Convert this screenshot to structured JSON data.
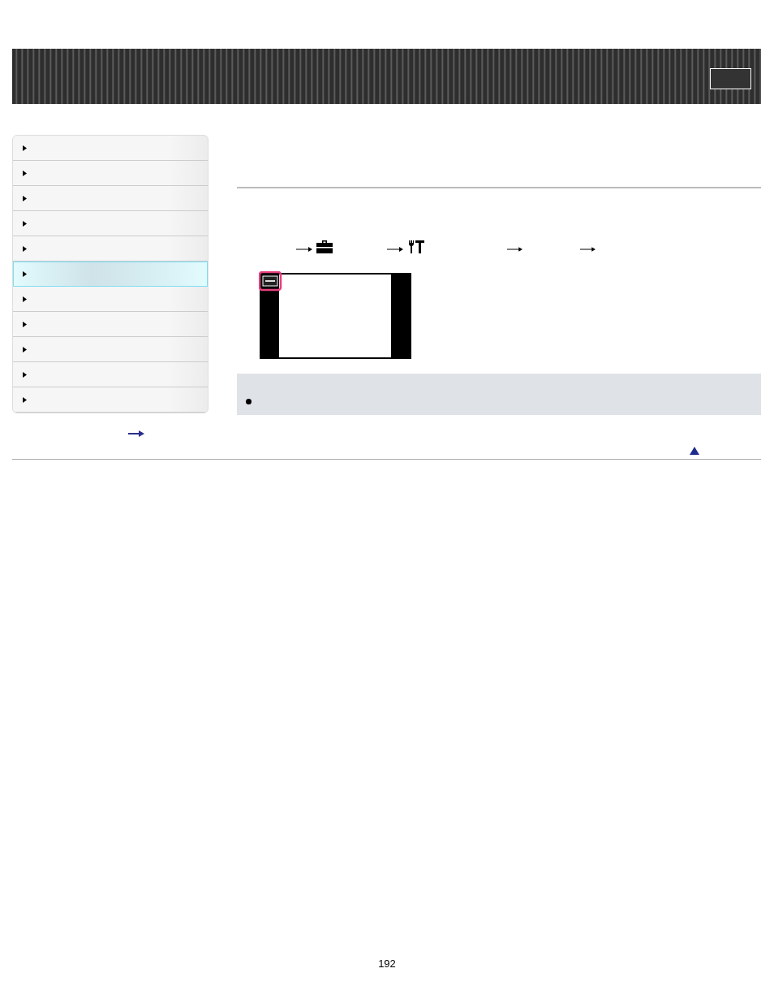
{
  "sidebar": {
    "items": [
      {
        "selected": false
      },
      {
        "selected": false
      },
      {
        "selected": false
      },
      {
        "selected": false
      },
      {
        "selected": false
      },
      {
        "selected": true
      },
      {
        "selected": false
      },
      {
        "selected": false
      },
      {
        "selected": false
      },
      {
        "selected": false
      },
      {
        "selected": false
      }
    ]
  },
  "page_number": "192"
}
